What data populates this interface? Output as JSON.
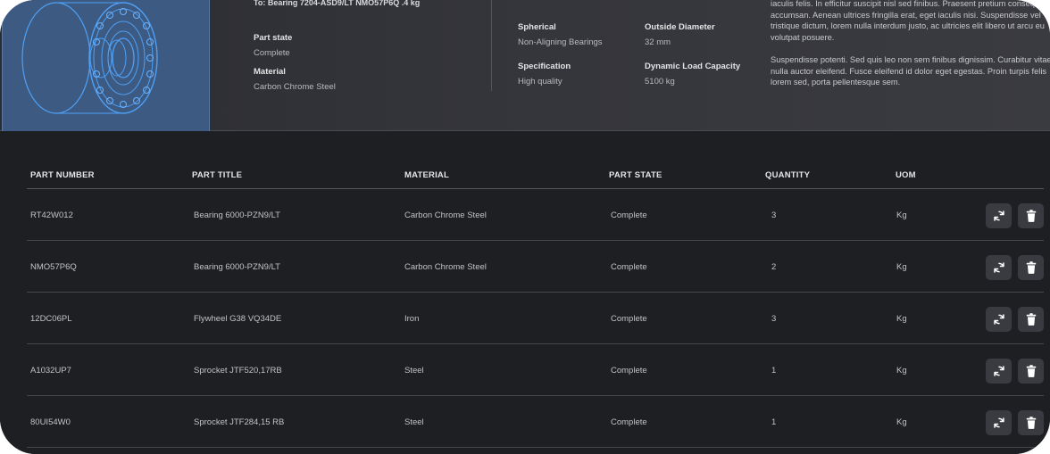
{
  "header": {
    "subtitle": "To: Bearing 7204-ASD9/LT NMO57P6Q .4 kg",
    "fields_left": [
      {
        "label": "Part state",
        "value": "Complete"
      },
      {
        "label": "Material",
        "value": "Carbon Chrome Steel"
      }
    ],
    "fields_mid": [
      {
        "label": "Spherical",
        "value": "Non-Aligning Bearings"
      },
      {
        "label": "Outside Diameter",
        "value": "32 mm"
      },
      {
        "label": "Specification",
        "value": "High quality"
      },
      {
        "label": "Dynamic Load Capacity",
        "value": "5100 kg"
      }
    ],
    "description": "iaculis felis. In efficitur suscipit nisl sed finibus. Praesent pretium consequat accumsan. Aenean ultrices fringilla erat, eget iaculis nisi. Suspendisse vel tristique dictum, lorem nulla interdum justo, ac ultricies elit libero ut arcu eu volutpat posuere.\n\nSuspendisse potenti. Sed quis leo non sem finibus dignissim. Curabitur vitae nulla auctor eleifend. Fusce eleifend id dolor eget egestas. Proin turpis felis lorem sed, porta pellentesque sem."
  },
  "table": {
    "columns": [
      "PART NUMBER",
      "PART TITLE",
      "MATERIAL",
      "PART STATE",
      "QUANTITY",
      "UOM"
    ],
    "rows": [
      {
        "part_number": "RT42W012",
        "part_title": "Bearing 6000-PZN9/LT",
        "material": "Carbon Chrome Steel",
        "part_state": "Complete",
        "quantity": "3",
        "uom": "Kg"
      },
      {
        "part_number": "NMO57P6Q",
        "part_title": "Bearing 6000-PZN9/LT",
        "material": "Carbon Chrome Steel",
        "part_state": "Complete",
        "quantity": "2",
        "uom": "Kg"
      },
      {
        "part_number": "12DC06PL",
        "part_title": "Flywheel G38 VQ34DE",
        "material": "Iron",
        "part_state": "Complete",
        "quantity": "3",
        "uom": "Kg"
      },
      {
        "part_number": "A1032UP7",
        "part_title": "Sprocket JTF520,17RB",
        "material": "Steel",
        "part_state": "Complete",
        "quantity": "1",
        "uom": "Kg"
      },
      {
        "part_number": "80UI54W0",
        "part_title": "Sprocket JTF284,15 RB",
        "material": "Steel",
        "part_state": "Complete",
        "quantity": "1",
        "uom": "Kg"
      }
    ],
    "row_actions": {
      "icons": [
        "refresh-icon",
        "trash-icon"
      ]
    }
  },
  "colors": {
    "background": "#1e1f23",
    "header": "#34353b",
    "thumb": "#3c5a82",
    "line_art": "#4a9cf0"
  }
}
